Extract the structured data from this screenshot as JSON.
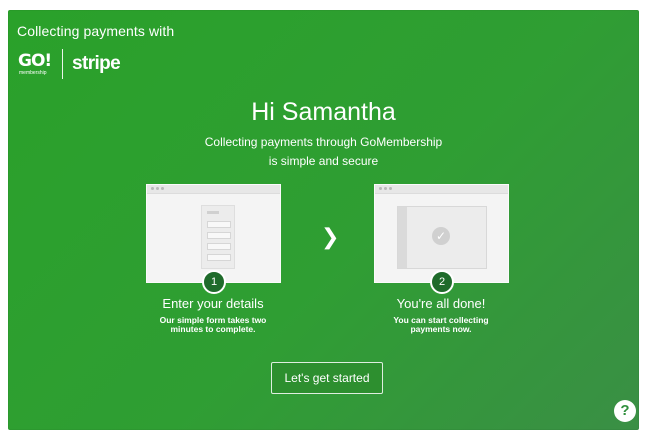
{
  "header": {
    "collecting_text": "Collecting payments with",
    "go_logo_text": "GO!",
    "go_logo_sub": "membership",
    "stripe_logo_text": "stripe"
  },
  "main": {
    "greeting": "Hi Samantha",
    "subtitle_line1": "Collecting payments through GoMembership",
    "subtitle_line2": "is simple and secure"
  },
  "steps": [
    {
      "number": "1",
      "title": "Enter your details",
      "desc_line1": "Our simple form takes two",
      "desc_line2": "minutes to complete."
    },
    {
      "number": "2",
      "title": "You're all done!",
      "desc_line1": "You can start collecting",
      "desc_line2": "payments now."
    }
  ],
  "icons": {
    "arrow": "chevron-right-icon",
    "check": "check-circle-icon",
    "help": "help-icon"
  },
  "buttons": {
    "start_label": "Let's get started"
  },
  "help": {
    "glyph": "?"
  },
  "colors": {
    "panel_green": "#2aa12a",
    "badge_green": "#1f6b2b"
  }
}
